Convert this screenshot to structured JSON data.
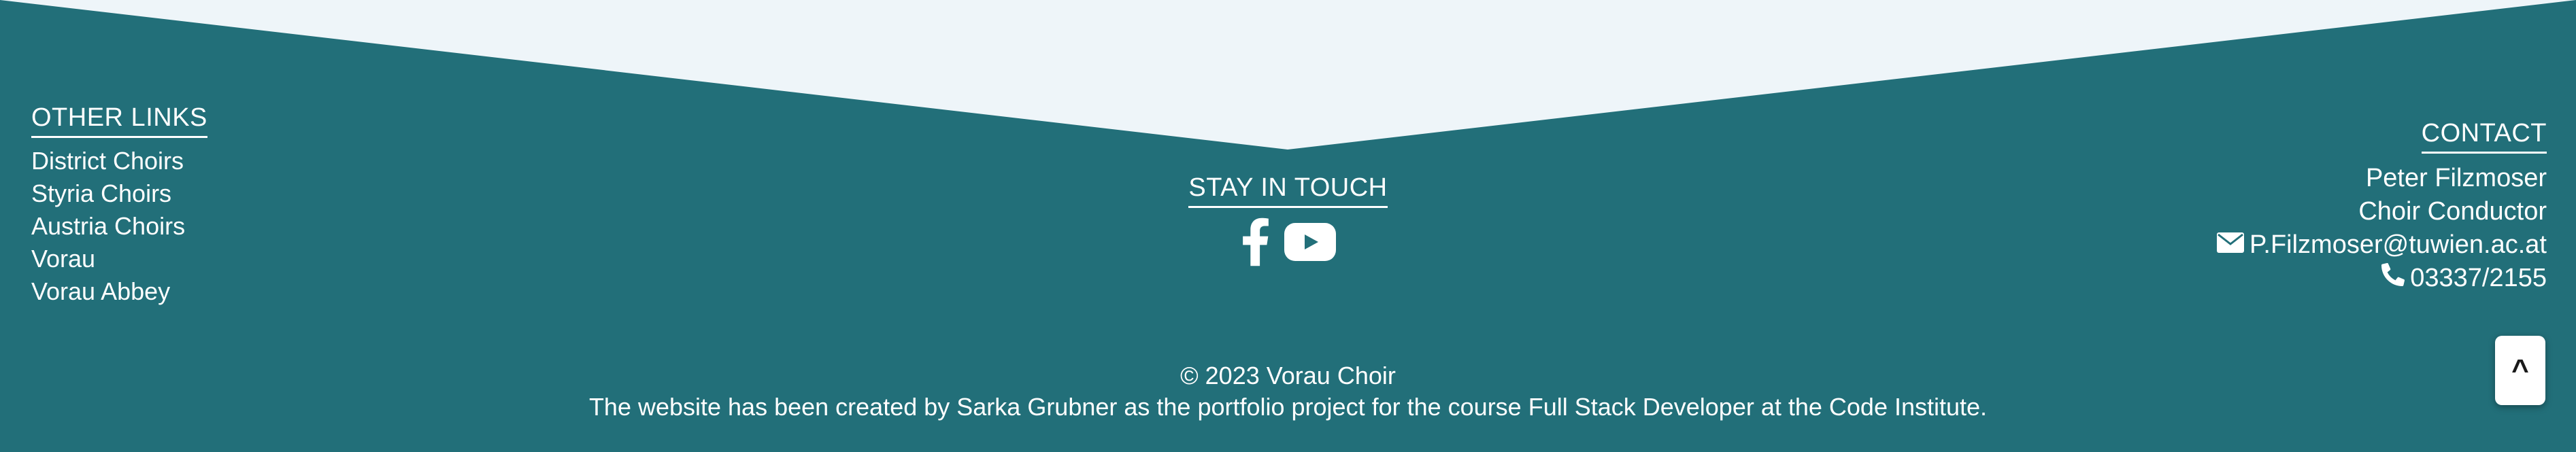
{
  "colors": {
    "background": "#226f79",
    "wedge": "#eef5f9",
    "text": "#ffffff"
  },
  "other_links": {
    "heading": "OTHER LINKS",
    "items": [
      {
        "label": "District Choirs"
      },
      {
        "label": "Styria Choirs"
      },
      {
        "label": "Austria Choirs"
      },
      {
        "label": "Vorau"
      },
      {
        "label": "Vorau Abbey"
      }
    ]
  },
  "stay_in_touch": {
    "heading": "STAY IN TOUCH",
    "icons": [
      "facebook-icon",
      "youtube-icon"
    ]
  },
  "contact": {
    "heading": "CONTACT",
    "name": "Peter Filzmoser",
    "role": "Choir Conductor",
    "email": "P.Filzmoser@tuwien.ac.at",
    "phone": "03337/2155"
  },
  "footer": {
    "copyright": "© 2023 Vorau Choir",
    "credit": "The website has been created by Sarka Grubner as the portfolio project for the course Full Stack Developer at the Code Institute."
  },
  "scroll_top": {
    "label": "^"
  }
}
